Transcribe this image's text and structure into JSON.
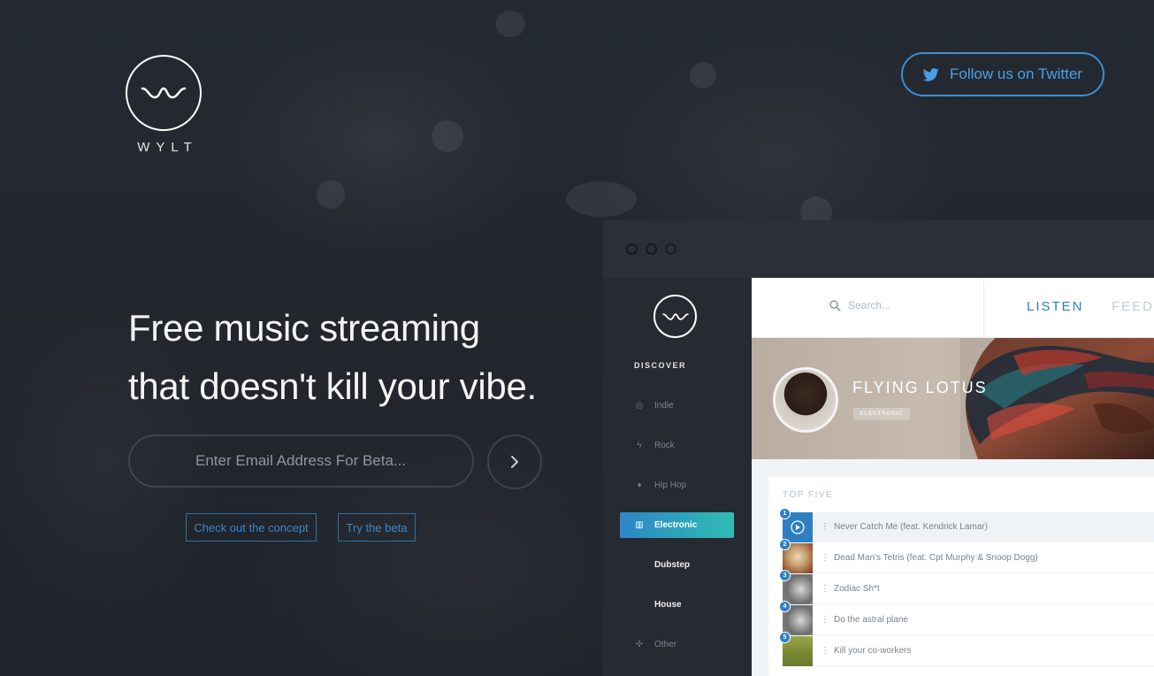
{
  "brand": {
    "name": "WYLT"
  },
  "header": {
    "twitter_label": "Follow us on Twitter"
  },
  "hero": {
    "headline_line1": "Free music streaming",
    "headline_line2": "that doesn't kill your vibe."
  },
  "signup": {
    "email_placeholder": "Enter Email Address For Beta...",
    "concept_link": "Check out the concept",
    "beta_link": "Try the beta"
  },
  "app": {
    "search_placeholder": "Search...",
    "tabs": [
      "LISTEN",
      "FEED"
    ],
    "sidebar": {
      "heading": "DISCOVER",
      "items": [
        {
          "label": "Indie",
          "icon": "vinyl-icon"
        },
        {
          "label": "Rock",
          "icon": "lightning-icon"
        },
        {
          "label": "Hip Hop",
          "icon": "microphone-icon"
        },
        {
          "label": "Electronic",
          "icon": "keyboard-icon",
          "active": true
        },
        {
          "label": "Dubstep"
        },
        {
          "label": "House"
        },
        {
          "label": "Other",
          "icon": "compass-icon"
        }
      ]
    },
    "artist": {
      "name": "FLYING LOTUS",
      "genre": "ELECTRONIC"
    },
    "top_five": {
      "title": "TOP FIVE",
      "tracks": [
        {
          "rank": "1",
          "title": "Never Catch Me (feat. Kendrick Lamar)",
          "playing": true
        },
        {
          "rank": "2",
          "title": "Dead Man's Tetris (feat. Cpt Murphy & Snoop Dogg)"
        },
        {
          "rank": "3",
          "title": "Zodiac Sh*t"
        },
        {
          "rank": "4",
          "title": "Do the astral plane"
        },
        {
          "rank": "5",
          "title": "Kill your co-workers"
        }
      ]
    }
  },
  "colors": {
    "accent": "#2e86c7",
    "accent2": "#2fbcb3",
    "twitter": "#4aa0e6",
    "background": "#23272f"
  }
}
